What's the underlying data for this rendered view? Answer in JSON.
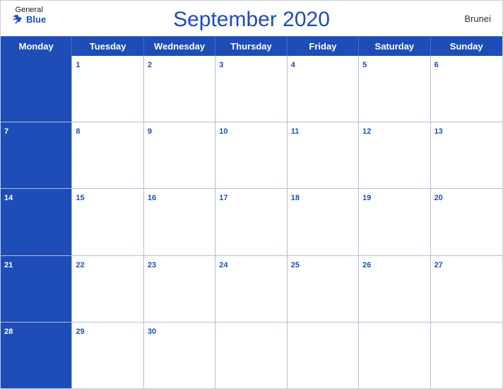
{
  "header": {
    "title": "September 2020",
    "country": "Brunei",
    "logo": {
      "general": "General",
      "blue": "Blue"
    }
  },
  "days": {
    "headers": [
      "Monday",
      "Tuesday",
      "Wednesday",
      "Thursday",
      "Friday",
      "Saturday",
      "Sunday"
    ]
  },
  "weeks": [
    [
      {
        "num": "",
        "empty": true
      },
      {
        "num": "1"
      },
      {
        "num": "2"
      },
      {
        "num": "3"
      },
      {
        "num": "4"
      },
      {
        "num": "5"
      },
      {
        "num": "6"
      }
    ],
    [
      {
        "num": "7"
      },
      {
        "num": "8"
      },
      {
        "num": "9"
      },
      {
        "num": "10"
      },
      {
        "num": "11"
      },
      {
        "num": "12"
      },
      {
        "num": "13"
      }
    ],
    [
      {
        "num": "14"
      },
      {
        "num": "15"
      },
      {
        "num": "16"
      },
      {
        "num": "17"
      },
      {
        "num": "18"
      },
      {
        "num": "19"
      },
      {
        "num": "20"
      }
    ],
    [
      {
        "num": "21"
      },
      {
        "num": "22"
      },
      {
        "num": "23"
      },
      {
        "num": "24"
      },
      {
        "num": "25"
      },
      {
        "num": "26"
      },
      {
        "num": "27"
      }
    ],
    [
      {
        "num": "28"
      },
      {
        "num": "29"
      },
      {
        "num": "30"
      },
      {
        "num": "",
        "empty": true
      },
      {
        "num": "",
        "empty": true
      },
      {
        "num": "",
        "empty": true
      },
      {
        "num": "",
        "empty": true
      }
    ]
  ]
}
